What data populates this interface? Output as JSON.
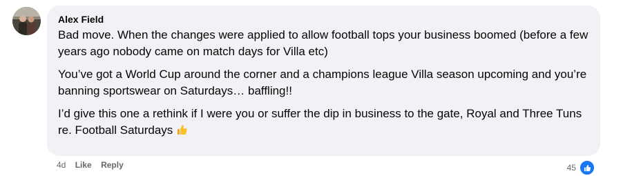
{
  "comment": {
    "author": "Alex Field",
    "paragraphs": [
      "Bad move. When the changes were applied to allow football tops your business boomed (before a few years ago nobody came on match days for Villa etc)",
      "You’ve got a World Cup around the corner and a champions league Villa season upcoming and you’re banning sportswear on Saturdays… baffling!!",
      "I’d give this one a rethink if I were you or suffer the dip in business to the gate, Royal and Three Tuns re. Football Saturdays"
    ],
    "emoji": "thumbs-up-icon"
  },
  "actions": {
    "time": "4d",
    "like_label": "Like",
    "reply_label": "Reply"
  },
  "reactions": {
    "count": "45",
    "icon": "like-icon",
    "color": "#1877f2"
  }
}
